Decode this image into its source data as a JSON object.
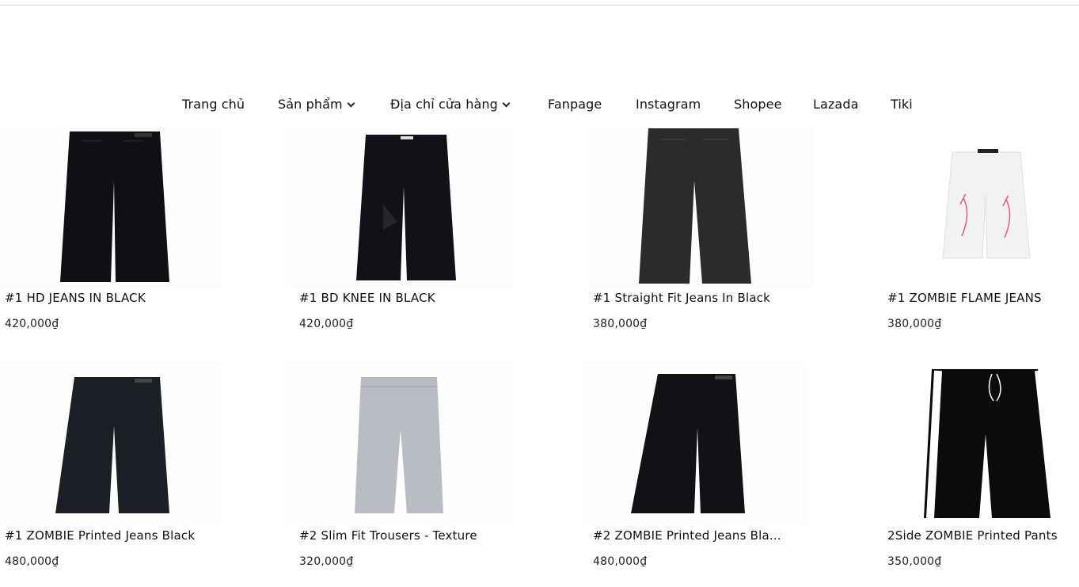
{
  "nav": {
    "items": [
      {
        "label": "Trang chủ",
        "dropdown": false
      },
      {
        "label": "Sản phẩm",
        "dropdown": true
      },
      {
        "label": "Địa chỉ cửa hàng",
        "dropdown": true
      },
      {
        "label": "Fanpage",
        "dropdown": false
      },
      {
        "label": "Instagram",
        "dropdown": false
      },
      {
        "label": "Shopee",
        "dropdown": false
      },
      {
        "label": "Lazada",
        "dropdown": false
      },
      {
        "label": "Tiki",
        "dropdown": false
      }
    ]
  },
  "products": [
    {
      "title": "#1 HD JEANS IN BLACK",
      "price": "420,000₫",
      "image": "black-jeans-back"
    },
    {
      "title": "#1 BD KNEE IN BLACK",
      "price": "420,000₫",
      "image": "black-ripped-knee-jeans"
    },
    {
      "title": "#1 Straight Fit Jeans In Black",
      "price": "380,000₫",
      "image": "washed-black-jeans-back"
    },
    {
      "title": "#1 ZOMBIE FLAME JEANS",
      "price": "380,000₫",
      "image": "white-flame-jeans"
    },
    {
      "title": "#1 ZOMBIE Printed Jeans Black",
      "price": "480,000₫",
      "image": "black-printed-jeans-back"
    },
    {
      "title": "#2 Slim Fit Trousers - Texture",
      "price": "320,000₫",
      "image": "grey-textured-trousers"
    },
    {
      "title": "#2 ZOMBIE Printed Jeans Bla...",
      "price": "480,000₫",
      "image": "black-printed-jeans-back"
    },
    {
      "title": "2Side ZOMBIE Printed Pants",
      "price": "350,000₫",
      "image": "black-side-stripe-pants"
    }
  ]
}
